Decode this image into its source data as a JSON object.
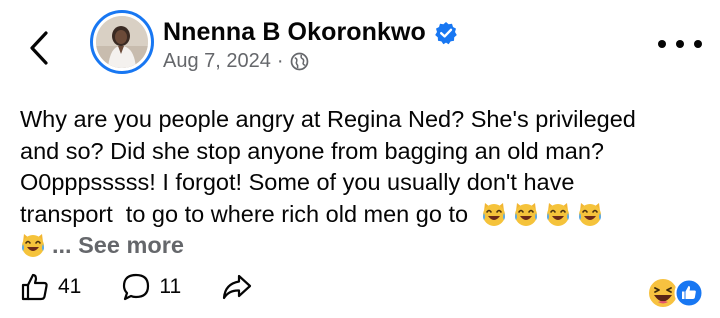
{
  "author": {
    "name": "Nnenna B Okoronkwo",
    "date": "Aug 7, 2024",
    "separator": "·"
  },
  "post": {
    "lines": [
      "Why are you people angry at Regina Ned? She's privileged",
      "and so? Did she stop anyone from bagging an old man?",
      "O0pppsssss! I forgot! Some of you usually don't have",
      "transport  to go to where rich old men go to"
    ],
    "ellipsis": "...",
    "see_more_label": "See more"
  },
  "engagement": {
    "likes": "41",
    "comments": "11"
  },
  "icons": {
    "back": "back-chevron-icon",
    "verified": "verified-badge-icon",
    "audience": "globe-icon",
    "more": "more-options-icon",
    "laugh_emoji": "laughing-crying-cat-emoji",
    "like": "thumbs-up-icon",
    "comment": "comment-bubble-icon",
    "share": "share-arrow-icon",
    "reaction_haha": "haha-reaction-icon",
    "reaction_like": "like-reaction-icon"
  },
  "colors": {
    "brand_blue": "#1877f2",
    "text_primary": "#050505",
    "text_secondary": "#65676b"
  }
}
